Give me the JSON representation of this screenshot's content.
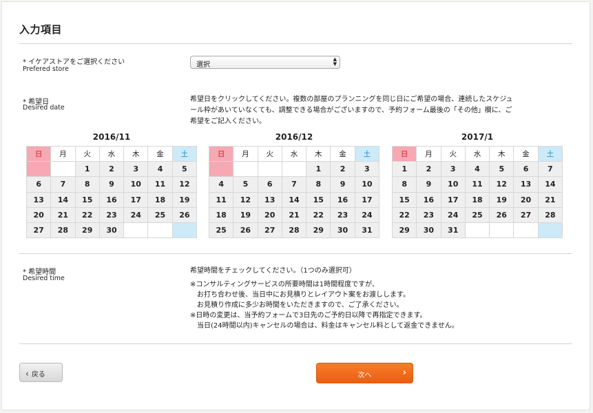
{
  "page": {
    "title": "入力項目"
  },
  "store": {
    "label_ja": "* イケアストアをご選択ください",
    "label_en": "Prefered store",
    "select_value": "選択"
  },
  "date": {
    "label_ja": "* 希望日",
    "label_en": "Desired date",
    "note_lines": [
      "希望日をクリックしてください。複数の部屋のプランニングを同じ日にご希望の場合、連続したスケジュ",
      "ール枠があいていなくても、調整できる場合がございますので、予約フォーム最後の「その他」欄に、ご",
      "希望をご記入ください。"
    ]
  },
  "weekdays": [
    "日",
    "月",
    "火",
    "水",
    "木",
    "金",
    "土"
  ],
  "calendars": [
    {
      "month": "2016/11",
      "weeks": [
        [
          "",
          "",
          "1",
          "2",
          "3",
          "4",
          "5"
        ],
        [
          "6",
          "7",
          "8",
          "9",
          "10",
          "11",
          "12"
        ],
        [
          "13",
          "14",
          "15",
          "16",
          "17",
          "18",
          "19"
        ],
        [
          "20",
          "21",
          "22",
          "23",
          "24",
          "25",
          "26"
        ],
        [
          "27",
          "28",
          "29",
          "30",
          "",
          "",
          ""
        ]
      ]
    },
    {
      "month": "2016/12",
      "weeks": [
        [
          "",
          "",
          "",
          "",
          "1",
          "2",
          "3"
        ],
        [
          "4",
          "5",
          "6",
          "7",
          "8",
          "9",
          "10"
        ],
        [
          "11",
          "12",
          "13",
          "14",
          "15",
          "16",
          "17"
        ],
        [
          "18",
          "19",
          "20",
          "21",
          "22",
          "23",
          "24"
        ],
        [
          "25",
          "26",
          "27",
          "28",
          "29",
          "30",
          "31"
        ]
      ]
    },
    {
      "month": "2017/1",
      "weeks": [
        [
          "1",
          "2",
          "3",
          "4",
          "5",
          "6",
          "7"
        ],
        [
          "8",
          "9",
          "10",
          "11",
          "12",
          "13",
          "14"
        ],
        [
          "15",
          "16",
          "17",
          "18",
          "19",
          "20",
          "21"
        ],
        [
          "22",
          "23",
          "24",
          "25",
          "26",
          "27",
          "28"
        ],
        [
          "29",
          "30",
          "31",
          "",
          "",
          "",
          ""
        ]
      ]
    }
  ],
  "time": {
    "label_ja": "* 希望時間",
    "label_en": "Desired time",
    "instruction": "希望時間をチェックしてください。（1つのみ選択可）",
    "note_lines": [
      "※コンサルティングサービスの所要時間は1時間程度ですが、",
      "　お打ち合わせ後、当日中にお見積りとレイアウト案をお渡しします。",
      "　お見積り作成に多少お時間をいただきますので、ご了承ください。",
      "※日時の変更は、当予約フォームで3日先のご予約日以降で再指定できます。",
      "　当日(24時間以内)キャンセルの場合は、料金はキャンセル料として返金できません。"
    ]
  },
  "buttons": {
    "back": "戻る",
    "next": "次へ"
  },
  "colors": {
    "accent": "#ec5d12",
    "sunday": "#f6a9b2",
    "saturday": "#cdeaf8"
  }
}
